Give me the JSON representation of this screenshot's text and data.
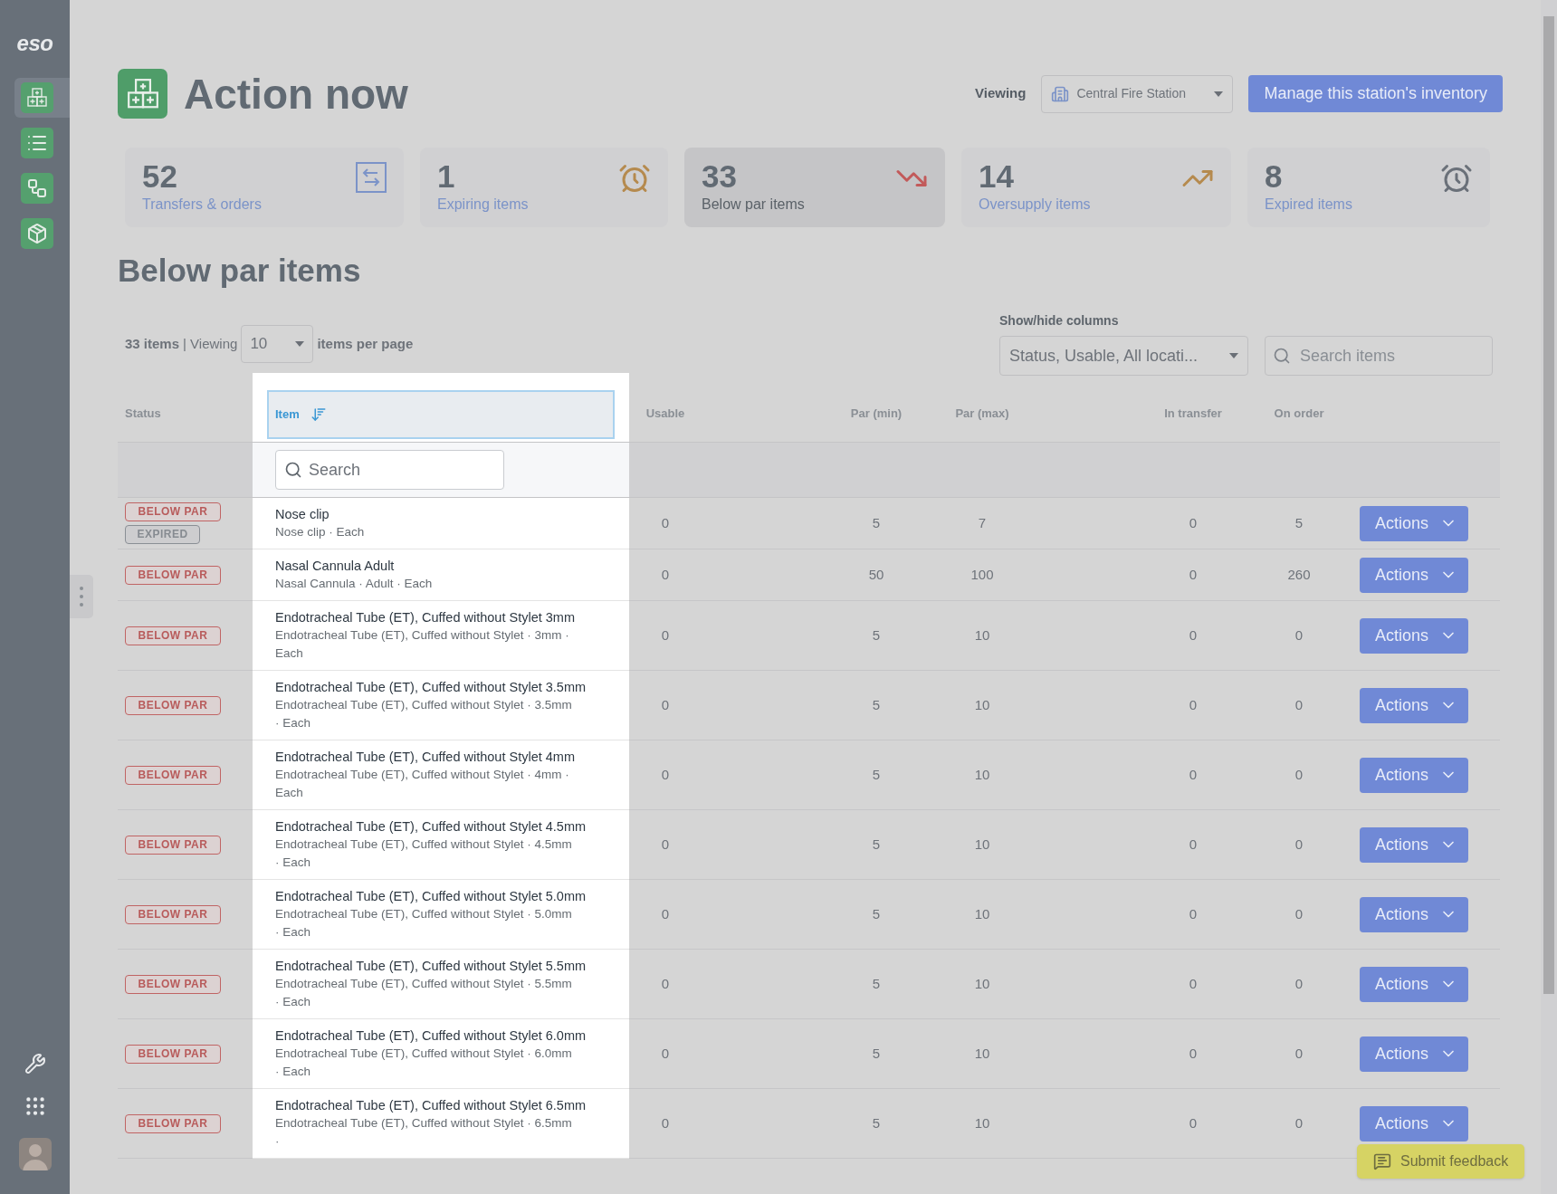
{
  "sidebar": {
    "logo": "eso",
    "nav": [
      {
        "kind": "boxes",
        "selected": true
      },
      {
        "kind": "list",
        "selected": false
      },
      {
        "kind": "workflow",
        "selected": false
      },
      {
        "kind": "cart",
        "selected": false
      }
    ]
  },
  "header": {
    "title": "Action now",
    "viewing_label": "Viewing",
    "station": "Central Fire Station",
    "manage_button": "Manage this station's inventory"
  },
  "stats": [
    {
      "kind": "transfers",
      "count": "52",
      "label": "Transfers & orders",
      "selected": false
    },
    {
      "kind": "expiring",
      "count": "1",
      "label": "Expiring items",
      "selected": false
    },
    {
      "kind": "below_par",
      "count": "33",
      "label": "Below par items",
      "selected": true
    },
    {
      "kind": "oversupply",
      "count": "14",
      "label": "Oversupply items",
      "selected": false
    },
    {
      "kind": "expired",
      "count": "8",
      "label": "Expired items",
      "selected": false
    }
  ],
  "section_title": "Below par items",
  "toolbar": {
    "count": "33 items",
    "viewing": "| Viewing",
    "per_page": "10",
    "per_page_suffix": "items per page",
    "columns_label": "Show/hide columns",
    "columns_value": "Status, Usable, All locati...",
    "search_placeholder": "Search items"
  },
  "table": {
    "columns": [
      {
        "label": "Status",
        "active": false
      },
      {
        "label": "Item",
        "active": true
      },
      {
        "label": "Usable",
        "active": false
      },
      {
        "label": "Par (min)",
        "active": false
      },
      {
        "label": "Par (max)",
        "active": false
      },
      {
        "label": "In transfer",
        "active": false
      },
      {
        "label": "On order",
        "active": false
      }
    ],
    "filter_placeholder": "Search",
    "rows": [
      {
        "statuses": [
          {
            "kind": "below_par",
            "label": "BELOW PAR"
          },
          {
            "kind": "expired",
            "label": "EXPIRED"
          }
        ],
        "name": "Nose clip",
        "detail": "Nose clip · Each",
        "usable": "0",
        "par_min": "5",
        "par_max": "7",
        "in_transfer": "0",
        "on_order": "5",
        "action": "Actions"
      },
      {
        "statuses": [
          {
            "kind": "below_par",
            "label": "BELOW PAR"
          }
        ],
        "name": "Nasal Cannula Adult",
        "detail": "Nasal Cannula · Adult · Each",
        "usable": "0",
        "par_min": "50",
        "par_max": "100",
        "in_transfer": "0",
        "on_order": "260",
        "action": "Actions"
      },
      {
        "statuses": [
          {
            "kind": "below_par",
            "label": "BELOW PAR"
          }
        ],
        "name": "Endotracheal Tube (ET), Cuffed without Stylet 3mm",
        "detail": "Endotracheal Tube (ET), Cuffed without Stylet · 3mm · Each",
        "usable": "0",
        "par_min": "5",
        "par_max": "10",
        "in_transfer": "0",
        "on_order": "0",
        "action": "Actions"
      },
      {
        "statuses": [
          {
            "kind": "below_par",
            "label": "BELOW PAR"
          }
        ],
        "name": "Endotracheal Tube (ET), Cuffed without Stylet 3.5mm",
        "detail": "Endotracheal Tube (ET), Cuffed without Stylet · 3.5mm · Each",
        "usable": "0",
        "par_min": "5",
        "par_max": "10",
        "in_transfer": "0",
        "on_order": "0",
        "action": "Actions"
      },
      {
        "statuses": [
          {
            "kind": "below_par",
            "label": "BELOW PAR"
          }
        ],
        "name": "Endotracheal Tube (ET), Cuffed without Stylet 4mm",
        "detail": "Endotracheal Tube (ET), Cuffed without Stylet · 4mm · Each",
        "usable": "0",
        "par_min": "5",
        "par_max": "10",
        "in_transfer": "0",
        "on_order": "0",
        "action": "Actions"
      },
      {
        "statuses": [
          {
            "kind": "below_par",
            "label": "BELOW PAR"
          }
        ],
        "name": "Endotracheal Tube (ET), Cuffed without Stylet 4.5mm",
        "detail": "Endotracheal Tube (ET), Cuffed without Stylet · 4.5mm · Each",
        "usable": "0",
        "par_min": "5",
        "par_max": "10",
        "in_transfer": "0",
        "on_order": "0",
        "action": "Actions"
      },
      {
        "statuses": [
          {
            "kind": "below_par",
            "label": "BELOW PAR"
          }
        ],
        "name": "Endotracheal Tube (ET), Cuffed without Stylet 5.0mm",
        "detail": "Endotracheal Tube (ET), Cuffed without Stylet · 5.0mm · Each",
        "usable": "0",
        "par_min": "5",
        "par_max": "10",
        "in_transfer": "0",
        "on_order": "0",
        "action": "Actions"
      },
      {
        "statuses": [
          {
            "kind": "below_par",
            "label": "BELOW PAR"
          }
        ],
        "name": "Endotracheal Tube (ET), Cuffed without Stylet 5.5mm",
        "detail": "Endotracheal Tube (ET), Cuffed without Stylet · 5.5mm · Each",
        "usable": "0",
        "par_min": "5",
        "par_max": "10",
        "in_transfer": "0",
        "on_order": "0",
        "action": "Actions"
      },
      {
        "statuses": [
          {
            "kind": "below_par",
            "label": "BELOW PAR"
          }
        ],
        "name": "Endotracheal Tube (ET), Cuffed without Stylet 6.0mm",
        "detail": "Endotracheal Tube (ET), Cuffed without Stylet · 6.0mm · Each",
        "usable": "0",
        "par_min": "5",
        "par_max": "10",
        "in_transfer": "0",
        "on_order": "0",
        "action": "Actions"
      },
      {
        "statuses": [
          {
            "kind": "below_par",
            "label": "BELOW PAR"
          }
        ],
        "name": "Endotracheal Tube (ET), Cuffed without Stylet 6.5mm",
        "detail": "Endotracheal Tube (ET), Cuffed without Stylet · 6.5mm ·",
        "usable": "0",
        "par_min": "5",
        "par_max": "10",
        "in_transfer": "0",
        "on_order": "0",
        "action": "Actions"
      }
    ]
  },
  "feedback_button": "Submit feedback"
}
